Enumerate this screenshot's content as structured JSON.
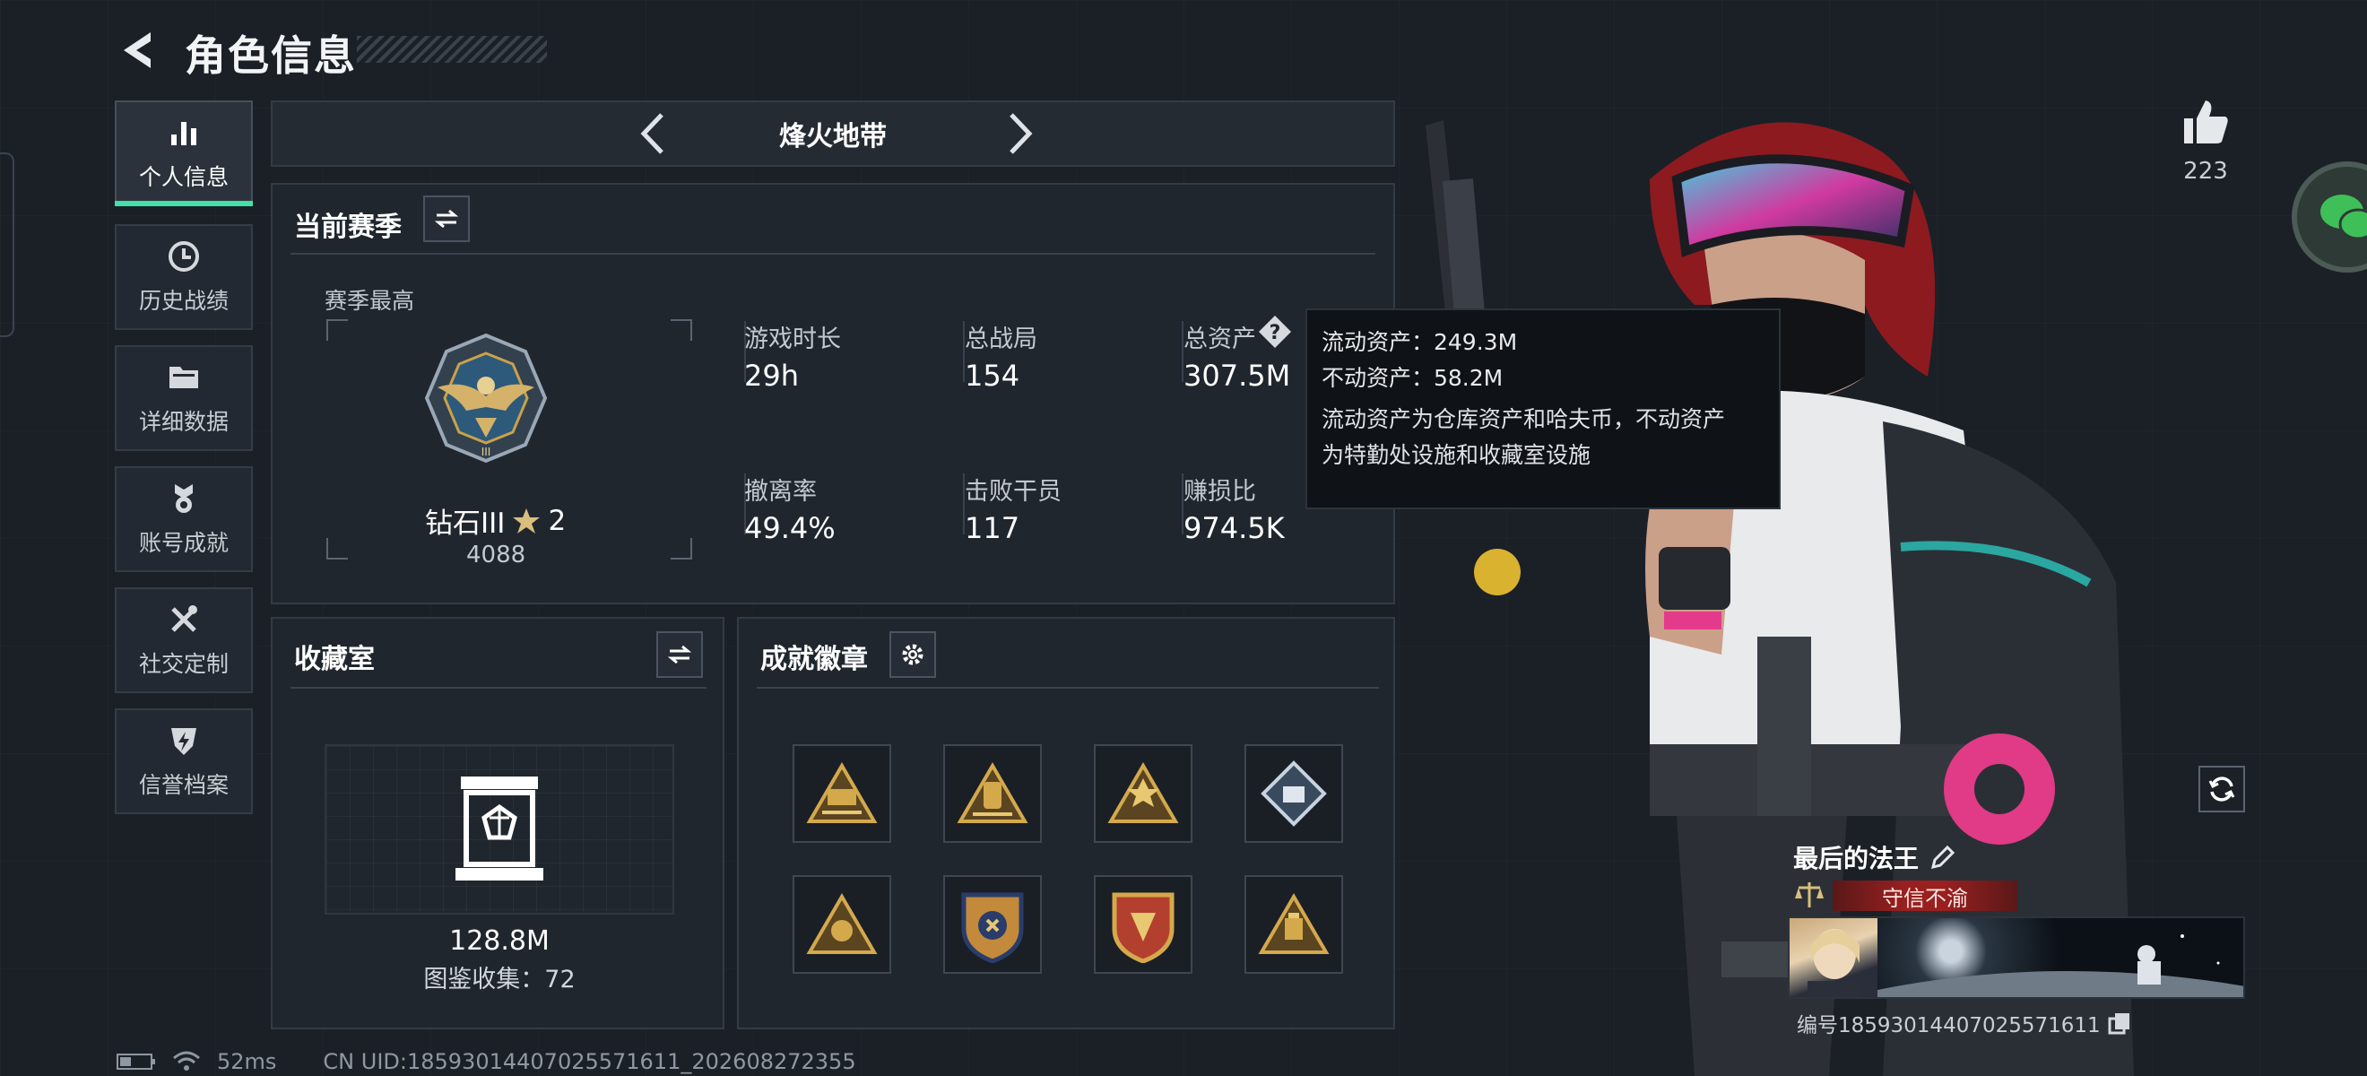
{
  "header": {
    "title": "角色信息"
  },
  "sidebar": {
    "items": [
      {
        "label": "个人信息",
        "icon": "bar-chart-icon",
        "active": true
      },
      {
        "label": "历史战绩",
        "icon": "clock-icon",
        "active": false
      },
      {
        "label": "详细数据",
        "icon": "folder-icon",
        "active": false
      },
      {
        "label": "账号成就",
        "icon": "medal-icon",
        "active": false
      },
      {
        "label": "社交定制",
        "icon": "tools-icon",
        "active": false
      },
      {
        "label": "信誉档案",
        "icon": "shield-bolt-icon",
        "active": false
      }
    ]
  },
  "map": {
    "name": "烽火地带"
  },
  "season": {
    "title": "当前赛季",
    "best_label": "赛季最高",
    "rank_name": "钻石III",
    "rank_stars": "2",
    "rank_points": "4088",
    "stats": [
      {
        "label": "游戏时长",
        "value": "29h"
      },
      {
        "label": "总战局",
        "value": "154"
      },
      {
        "label": "总资产",
        "value": "307.5M"
      },
      {
        "label": "撤离率",
        "value": "49.4%"
      },
      {
        "label": "击败干员",
        "value": "117"
      },
      {
        "label": "赚损比",
        "value": "974.5K"
      }
    ]
  },
  "tooltip": {
    "liquid": "流动资产：249.3M",
    "fixed": "不动资产：58.2M",
    "desc1": "流动资产为仓库资产和哈夫币，不动资产",
    "desc2": "为特勤处设施和收藏室设施"
  },
  "collection": {
    "title": "收藏室",
    "value": "128.8M",
    "catalog": "图鉴收集：72"
  },
  "achievements": {
    "title": "成就徽章"
  },
  "profile": {
    "likes": "223",
    "player_name": "最后的法王",
    "reputation": "守信不渝",
    "id_text": "编号18593014407025571611"
  },
  "status": {
    "ping": "52ms",
    "uid": "CN UID:18593014407025571611_202608272355"
  },
  "colors": {
    "accent": "#43e0a8",
    "gold": "#c9a24a",
    "reputation_red": "#8e1f1f",
    "wechat": "#3fbf58"
  }
}
